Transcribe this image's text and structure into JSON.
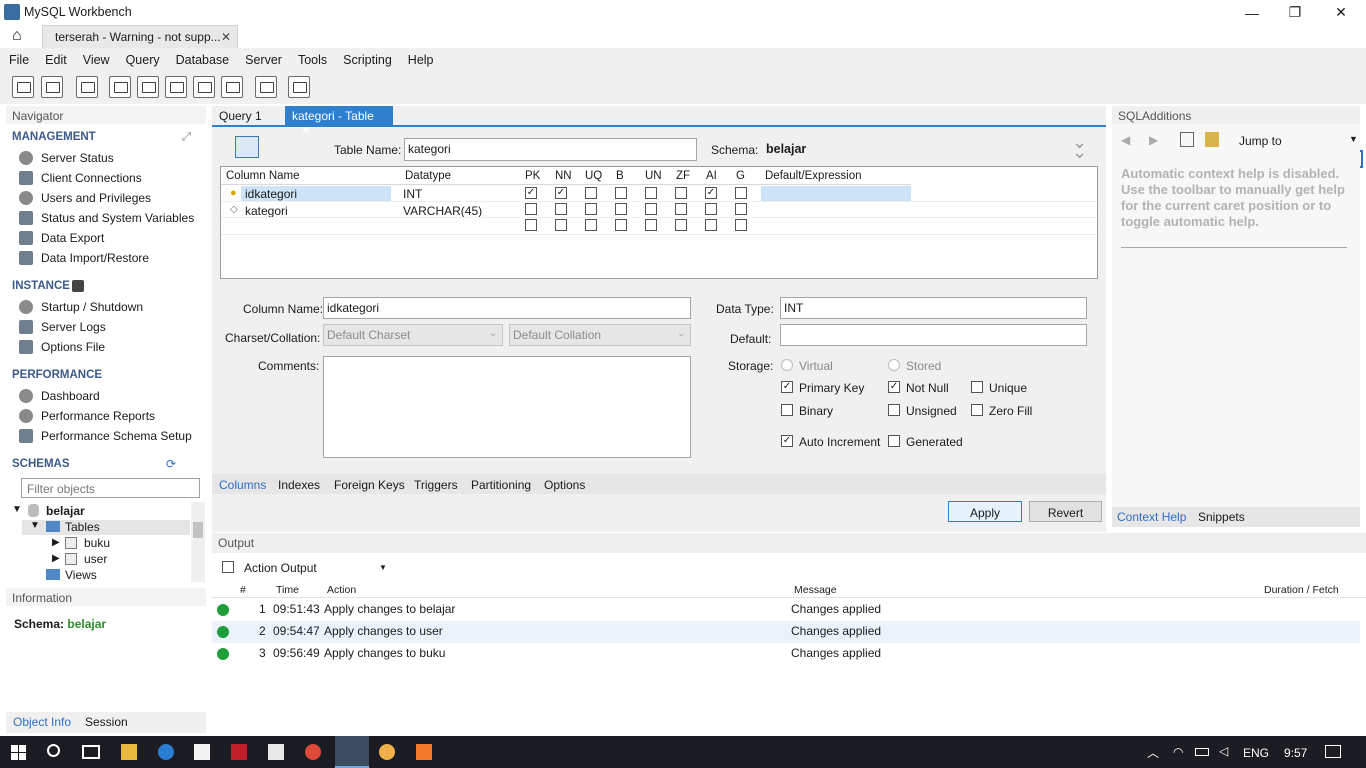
{
  "window": {
    "title": "MySQL Workbench",
    "doc_tab": "terserah - Warning - not supp...",
    "minimize": "—",
    "maximize": "❐",
    "close": "✕"
  },
  "menu": [
    "File",
    "Edit",
    "View",
    "Query",
    "Database",
    "Server",
    "Tools",
    "Scripting",
    "Help"
  ],
  "navigator": {
    "title": "Navigator",
    "management": {
      "label": "MANAGEMENT",
      "items": [
        "Server Status",
        "Client Connections",
        "Users and Privileges",
        "Status and System Variables",
        "Data Export",
        "Data Import/Restore"
      ]
    },
    "instance": {
      "label": "INSTANCE",
      "items": [
        "Startup / Shutdown",
        "Server Logs",
        "Options File"
      ]
    },
    "performance": {
      "label": "PERFORMANCE",
      "items": [
        "Dashboard",
        "Performance Reports",
        "Performance Schema Setup"
      ]
    },
    "schemas": {
      "label": "SCHEMAS",
      "filter_placeholder": "Filter objects",
      "db": "belajar",
      "tables": "Tables",
      "t1": "buku",
      "t2": "user",
      "views": "Views"
    }
  },
  "information": {
    "title": "Information",
    "schema_label": "Schema:",
    "schema_value": "belajar",
    "tabs": [
      "Object Info",
      "Session"
    ]
  },
  "editor": {
    "tabs": [
      "Query 1",
      "kategori - Table"
    ],
    "table_name_label": "Table Name:",
    "table_name": "kategori",
    "schema_label": "Schema:",
    "schema": "belajar",
    "headers": [
      "Column Name",
      "Datatype",
      "PK",
      "NN",
      "UQ",
      "B",
      "UN",
      "ZF",
      "AI",
      "G",
      "Default/Expression"
    ],
    "rows": [
      {
        "name": "idkategori",
        "type": "INT",
        "flags": [
          true,
          true,
          false,
          false,
          false,
          false,
          true,
          false
        ]
      },
      {
        "name": "kategori",
        "type": "VARCHAR(45)",
        "flags": [
          false,
          false,
          false,
          false,
          false,
          false,
          false,
          false
        ]
      }
    ],
    "column_name_label": "Column Name:",
    "column_name": "idkategori",
    "charset_label": "Charset/Collation:",
    "charset": "Default Charset",
    "collation": "Default Collation",
    "comments_label": "Comments:",
    "datatype_label": "Data Type:",
    "datatype": "INT",
    "default_label": "Default:",
    "storage_label": "Storage:",
    "storage": {
      "virtual": "Virtual",
      "stored": "Stored",
      "primary_key": "Primary Key",
      "not_null": "Not Null",
      "unique": "Unique",
      "binary": "Binary",
      "unsigned": "Unsigned",
      "zero_fill": "Zero Fill",
      "auto_increment": "Auto Increment",
      "generated": "Generated"
    },
    "subtabs": [
      "Columns",
      "Indexes",
      "Foreign Keys",
      "Triggers",
      "Partitioning",
      "Options"
    ],
    "apply": "Apply",
    "revert": "Revert"
  },
  "sql_additions": {
    "title": "SQLAdditions",
    "jump": "Jump to",
    "help": "Automatic context help is disabled. Use the toolbar to manually get help for the current caret position or to toggle automatic help.",
    "tabs": [
      "Context Help",
      "Snippets"
    ]
  },
  "output": {
    "title": "Output",
    "selector": "Action Output",
    "headers": [
      "#",
      "Time",
      "Action",
      "Message",
      "Duration / Fetch"
    ],
    "rows": [
      {
        "n": "1",
        "time": "09:51:43",
        "action": "Apply changes to belajar",
        "message": "Changes applied"
      },
      {
        "n": "2",
        "time": "09:54:47",
        "action": "Apply changes to user",
        "message": "Changes applied"
      },
      {
        "n": "3",
        "time": "09:56:49",
        "action": "Apply changes to buku",
        "message": "Changes applied"
      }
    ]
  },
  "taskbar": {
    "lang": "ENG",
    "time": "9:57"
  },
  "colors": {
    "accent": "#2f7fcf",
    "ok": "#1f9d3a",
    "schema_green": "#2e8b2e"
  }
}
